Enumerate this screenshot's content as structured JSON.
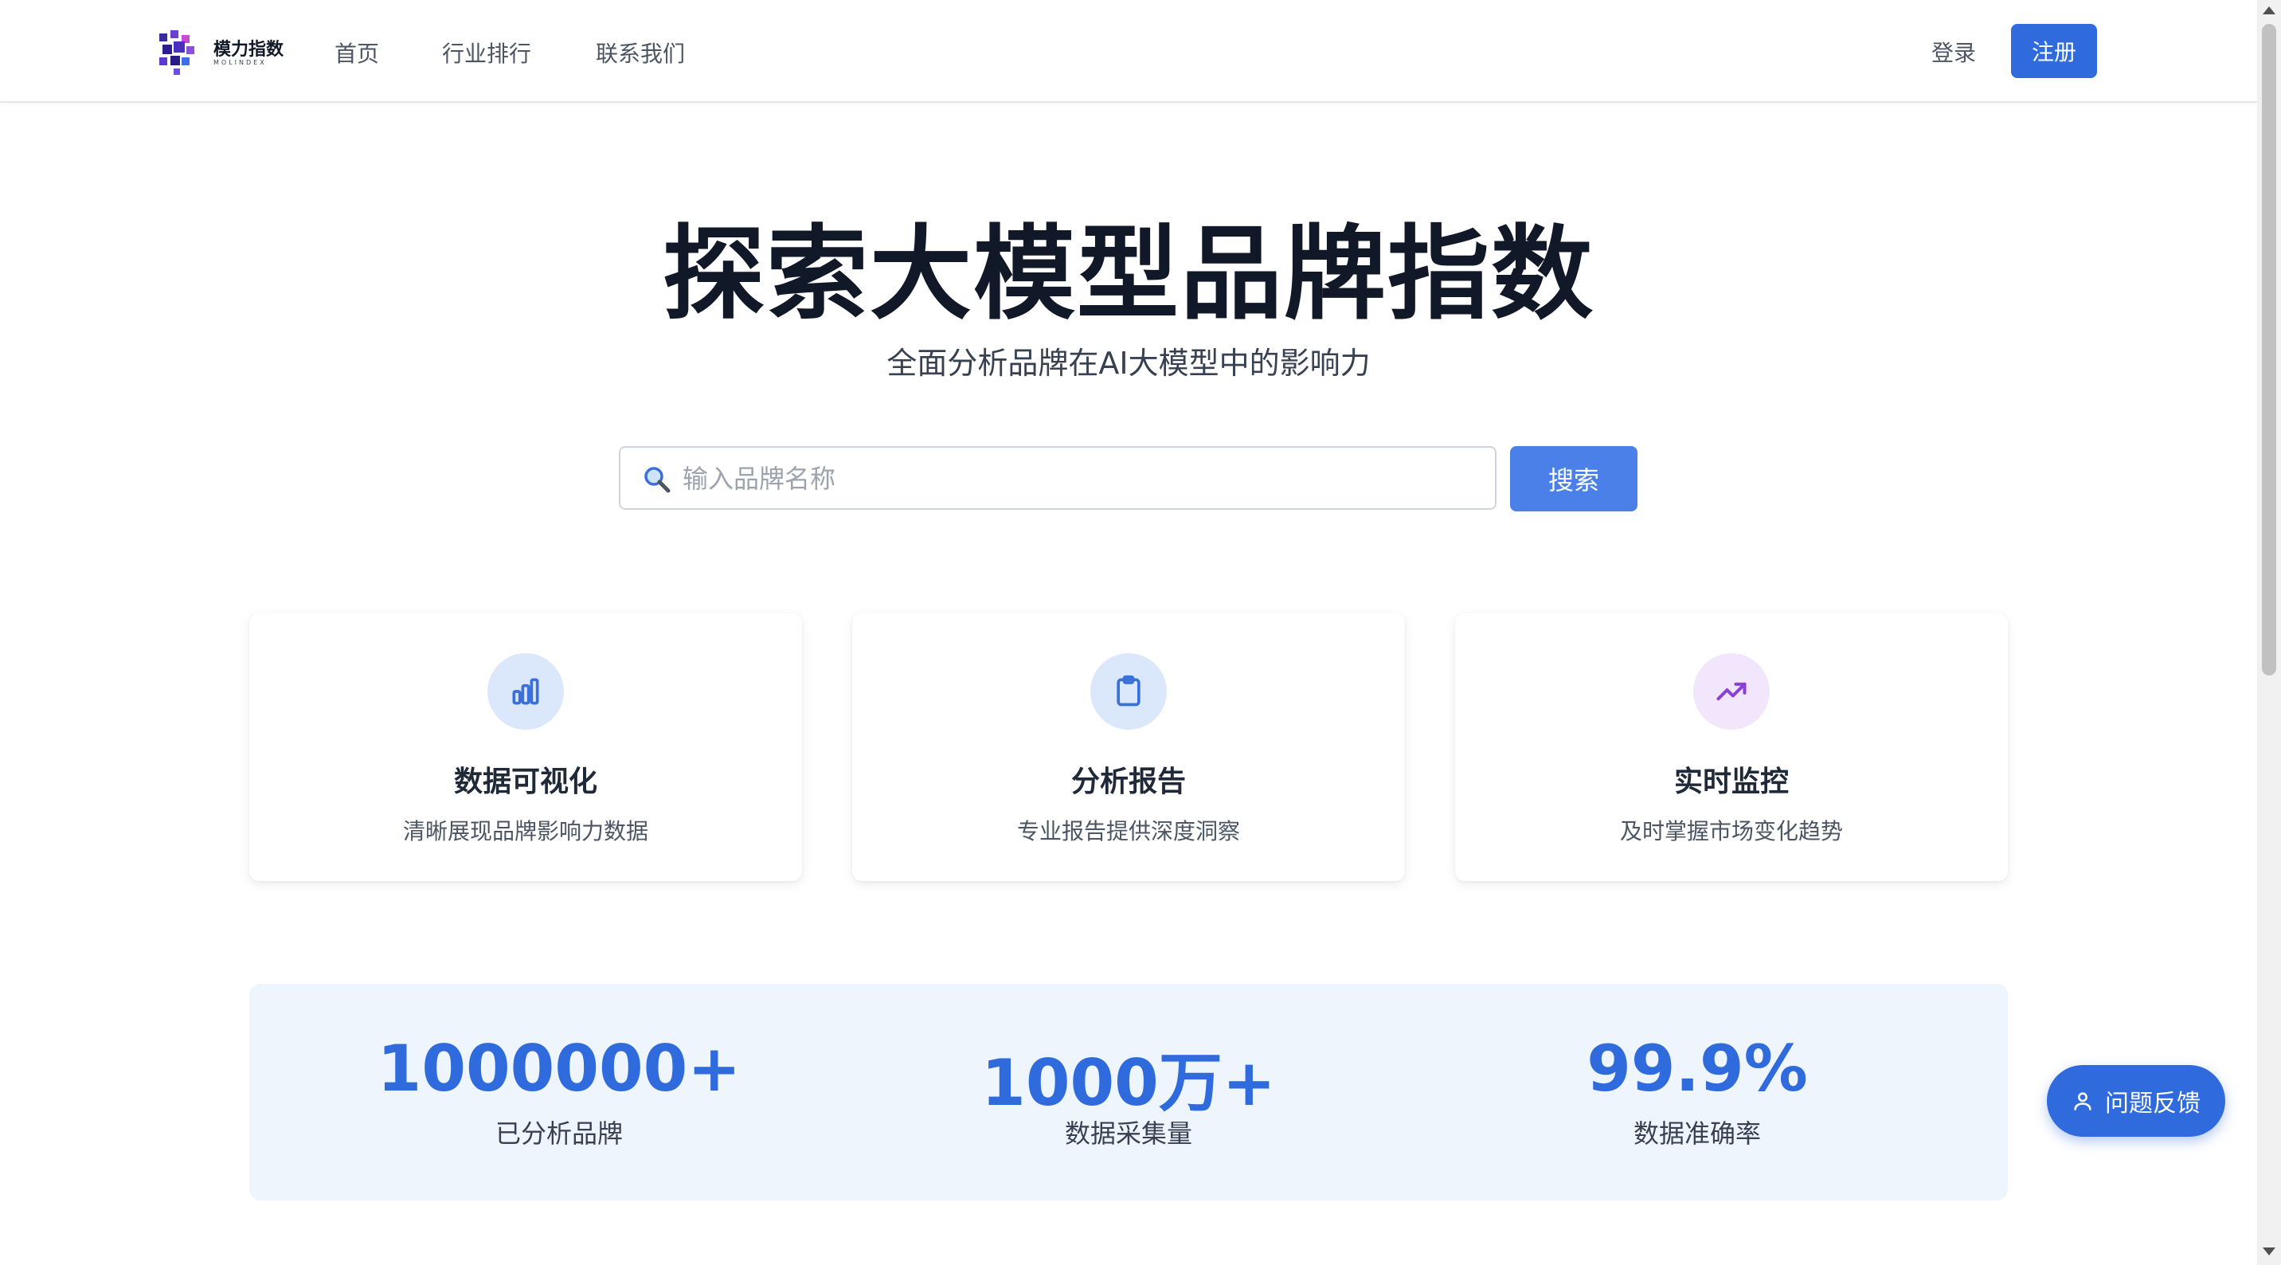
{
  "header": {
    "logo_text": "模力指数",
    "logo_subtext": "MOLINDEX",
    "nav": [
      "首页",
      "行业排行",
      "联系我们"
    ],
    "login_label": "登录",
    "register_label": "注册"
  },
  "hero": {
    "title": "探索大模型品牌指数",
    "subtitle": "全面分析品牌在AI大模型中的影响力"
  },
  "search": {
    "placeholder": "输入品牌名称",
    "button_label": "搜索"
  },
  "features": [
    {
      "icon": "bar-chart-icon",
      "title": "数据可视化",
      "desc": "清晰展现品牌影响力数据",
      "color": "#3b6fd9",
      "bg": "#dbe8fb"
    },
    {
      "icon": "clipboard-icon",
      "title": "分析报告",
      "desc": "专业报告提供深度洞察",
      "color": "#3b6fd9",
      "bg": "#dbe8fb"
    },
    {
      "icon": "trending-up-icon",
      "title": "实时监控",
      "desc": "及时掌握市场变化趋势",
      "color": "#8b3fd9",
      "bg": "#f1e6fb"
    }
  ],
  "stats": [
    {
      "value": "1000000+",
      "label": "已分析品牌"
    },
    {
      "value": "1000万+",
      "label": "数据采集量"
    },
    {
      "value": "99.9%",
      "label": "数据准确率"
    }
  ],
  "feedback_label": "问题反馈",
  "colors": {
    "primary": "#2f6bdc",
    "search_button": "#4a80e8",
    "stats_bg": "#eef5fd"
  }
}
